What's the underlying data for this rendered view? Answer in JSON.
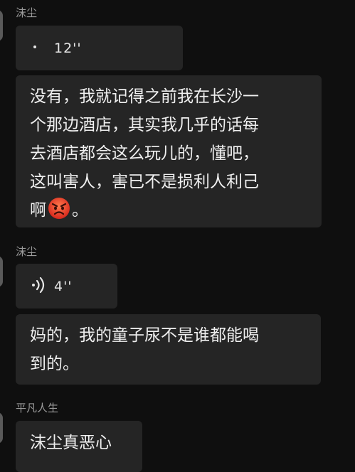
{
  "messages": [
    {
      "sender": "沫尘",
      "voice_duration": "12''"
    },
    {
      "text_lines": [
        "没有，我就记得之前我在长沙一",
        "个那边酒店，其实我几乎的话每",
        "去酒店都会这么玩儿的，懂吧，",
        "这叫害人，害已不是损利人利己"
      ],
      "last_line_before_emoji": "啊",
      "emoji": "angry-face-emoji",
      "last_line_after_emoji": "。"
    },
    {
      "sender": "沫尘",
      "voice_duration": "4''"
    },
    {
      "text_lines": [
        "妈的，我的童子尿不是谁都能喝",
        "到的。"
      ]
    },
    {
      "sender": "平凡人生",
      "text_lines": [
        "沫尘真恶心"
      ]
    }
  ],
  "colors": {
    "background": "#0f0f0f",
    "bubble": "#252525",
    "sender_name": "#9b9b9b",
    "text": "#efefef"
  }
}
